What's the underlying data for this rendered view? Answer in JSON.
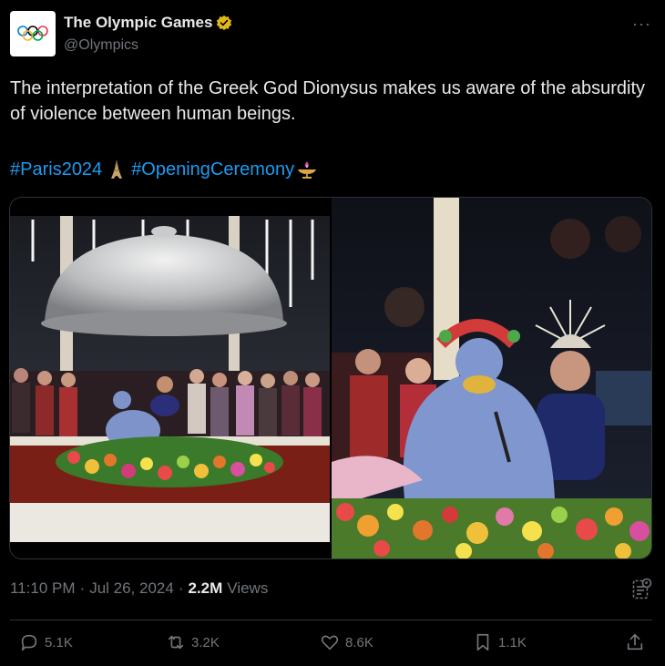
{
  "account": {
    "display_name": "The Olympic Games",
    "handle": "@Olympics",
    "verified_color": "#e2b719"
  },
  "tweet": {
    "text": "The interpretation of the Greek God Dionysus makes us aware of the absurdity of violence between human beings.",
    "hashtags": [
      "#Paris2024",
      "#OpeningCeremony"
    ],
    "time": "11:10 PM",
    "date": "Jul 26, 2024",
    "views_count": "2.2M",
    "views_label": "Views"
  },
  "actions": {
    "replies": "5.1K",
    "reposts": "3.2K",
    "likes": "8.6K",
    "bookmarks": "1.1K"
  },
  "colors": {
    "link": "#1d9bf0",
    "muted": "#71767b",
    "border": "#2f3336"
  }
}
